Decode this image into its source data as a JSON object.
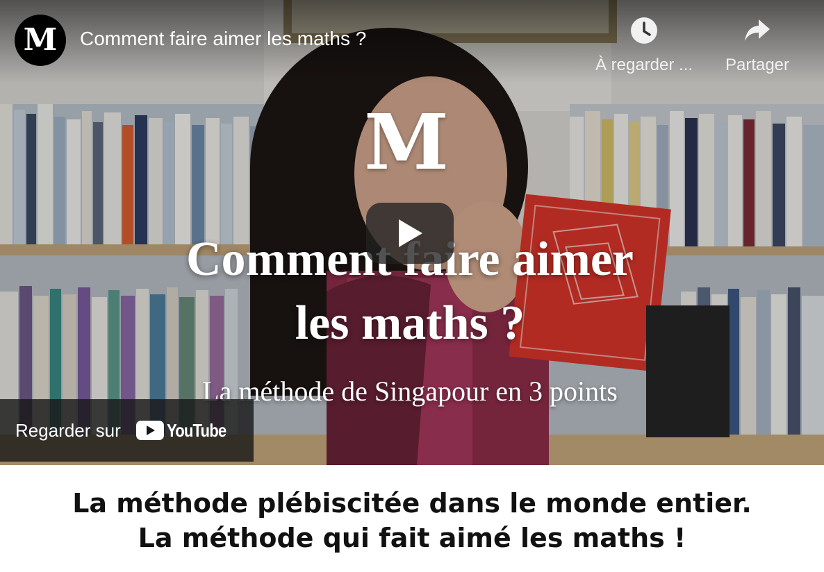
{
  "player": {
    "channel_avatar_letter": "M",
    "title": "Comment faire aimer les maths ?",
    "watch_later_label": "À regarder ...",
    "share_label": "Partager",
    "watch_on_label": "Regarder sur",
    "youtube_wordmark": "YouTube"
  },
  "thumbnail": {
    "logo_letter": "M",
    "title_line1": "Comment faire aimer",
    "title_line2": "les maths ?",
    "subtitle": "La méthode de Singapour en 3 points"
  },
  "caption": {
    "line1": "La méthode plébiscitée dans le monde entier.",
    "line2": "La méthode qui fait aimé les maths !"
  },
  "colors": {
    "youtube_red": "#ff0000",
    "book_red": "#d9352b",
    "overlay_dark": "#171717"
  }
}
